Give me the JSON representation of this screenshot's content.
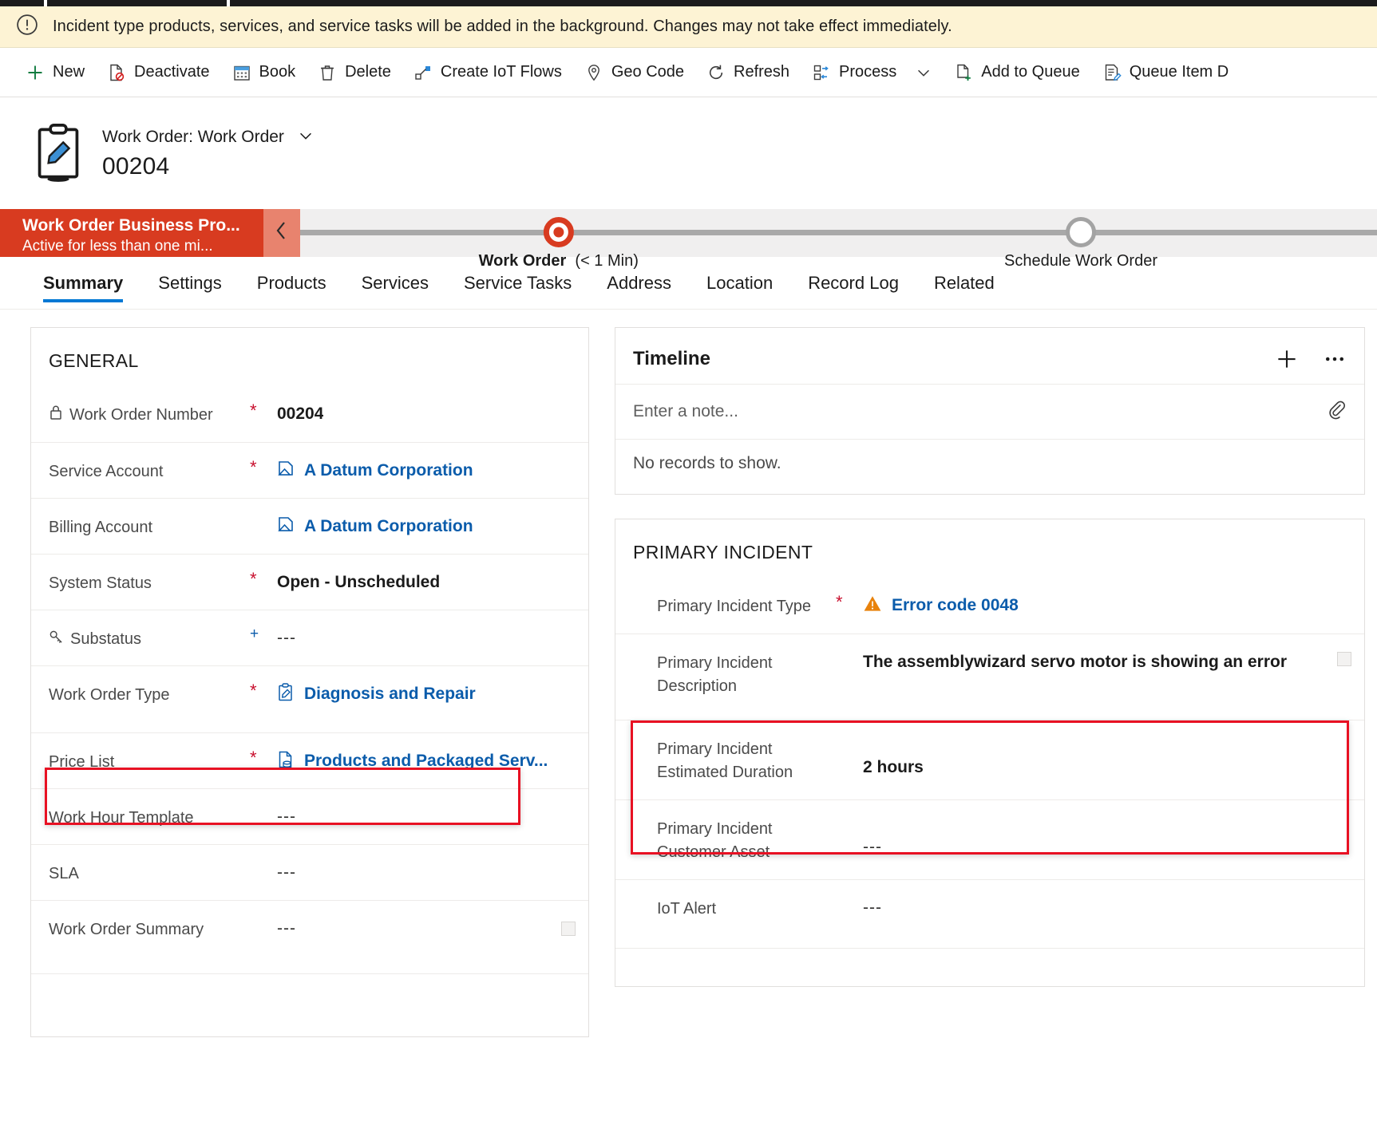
{
  "banner": {
    "icon": "warning-circle-icon",
    "text": "Incident type products, services, and service tasks will be added in the background. Changes may not take effect immediately."
  },
  "commandbar": {
    "items": [
      {
        "label": "New",
        "icon": "plus-icon"
      },
      {
        "label": "Deactivate",
        "icon": "deactivate-page-icon"
      },
      {
        "label": "Book",
        "icon": "calendar-icon"
      },
      {
        "label": "Delete",
        "icon": "trash-icon"
      },
      {
        "label": "Create IoT Flows",
        "icon": "iot-flows-icon"
      },
      {
        "label": "Geo Code",
        "icon": "map-pin-icon"
      },
      {
        "label": "Refresh",
        "icon": "refresh-icon"
      },
      {
        "label": "Process",
        "icon": "process-icon"
      },
      {
        "label": "Add to Queue",
        "icon": "add-to-queue-icon"
      },
      {
        "label": "Queue Item D",
        "icon": "queue-item-icon"
      }
    ],
    "process_caret": "chevron-down-icon"
  },
  "record_header": {
    "icon": "work-order-clipboard-icon",
    "entity_label": "Work Order: Work Order",
    "caret": "chevron-down-icon",
    "title": "00204"
  },
  "business_process": {
    "name": "Work Order Business Pro...",
    "status": "Active for less than one mi...",
    "collapse_icon": "chevron-left-icon",
    "stages": [
      {
        "label": "Work Order",
        "duration": "(< 1 Min)",
        "state": "active"
      },
      {
        "label": "Schedule Work Order",
        "duration": "",
        "state": "pending"
      }
    ]
  },
  "tabs": [
    {
      "label": "Summary",
      "active": true
    },
    {
      "label": "Settings",
      "active": false
    },
    {
      "label": "Products",
      "active": false
    },
    {
      "label": "Services",
      "active": false
    },
    {
      "label": "Service Tasks",
      "active": false
    },
    {
      "label": "Address",
      "active": false
    },
    {
      "label": "Location",
      "active": false
    },
    {
      "label": "Record Log",
      "active": false
    },
    {
      "label": "Related",
      "active": false
    }
  ],
  "general": {
    "title": "GENERAL",
    "fields": [
      {
        "label": "Work Order Number",
        "marker": "*",
        "value": "00204",
        "style": "bold",
        "label_icon": "lock-icon"
      },
      {
        "label": "Service Account",
        "marker": "*",
        "value": "A Datum Corporation",
        "style": "link",
        "value_icon": "lookup-record-icon"
      },
      {
        "label": "Billing Account",
        "marker": "",
        "value": "A Datum Corporation",
        "style": "link",
        "value_icon": "lookup-record-icon"
      },
      {
        "label": "System Status",
        "marker": "*",
        "value": "Open - Unscheduled",
        "style": "bold"
      },
      {
        "label": "Substatus",
        "marker": "+",
        "value": "---",
        "style": "dash",
        "label_icon": "key-icon"
      },
      {
        "label": "Work Order Type",
        "marker": "*",
        "value": "Diagnosis and Repair",
        "style": "link",
        "value_icon": "work-order-type-icon",
        "highlighted": true
      },
      {
        "label": "Price List",
        "marker": "*",
        "value": "Products and Packaged Serv...",
        "style": "link",
        "value_icon": "price-list-icon"
      },
      {
        "label": "Work Hour Template",
        "marker": "",
        "value": "---",
        "style": "dash"
      },
      {
        "label": "SLA",
        "marker": "",
        "value": "---",
        "style": "dash"
      },
      {
        "label": "Work Order Summary",
        "marker": "",
        "value": "---",
        "style": "dash",
        "grip": true
      }
    ]
  },
  "timeline": {
    "title": "Timeline",
    "add_icon": "plus-icon",
    "more_icon": "ellipsis-icon",
    "note_placeholder": "Enter a note...",
    "attach_icon": "paperclip-icon",
    "empty_text": "No records to show."
  },
  "primary_incident": {
    "title": "PRIMARY INCIDENT",
    "fields": [
      {
        "label": "Primary Incident Type",
        "marker": "*",
        "value": "Error code 0048",
        "style": "link",
        "value_icon": "warning-triangle-icon"
      },
      {
        "label": "Primary Incident Description",
        "marker": "",
        "value": "The assemblywizard servo motor is showing an error",
        "style": "bold",
        "grip": true,
        "highlighted": true
      },
      {
        "label": "Primary Incident Estimated Duration",
        "marker": "",
        "value": "2 hours",
        "style": "bold",
        "highlighted": true
      },
      {
        "label": "Primary Incident Customer Asset",
        "marker": "",
        "value": "---",
        "style": "dash"
      },
      {
        "label": "IoT Alert",
        "marker": "",
        "value": "---",
        "style": "dash"
      }
    ]
  },
  "colors": {
    "banner_bg": "#fdf3d4",
    "bpf_red": "#d83b20",
    "link_blue": "#0b5cab",
    "tab_accent": "#0078d4",
    "highlight_red": "#e81123",
    "required_red": "#c8102e",
    "warning_orange": "#e8820c"
  }
}
